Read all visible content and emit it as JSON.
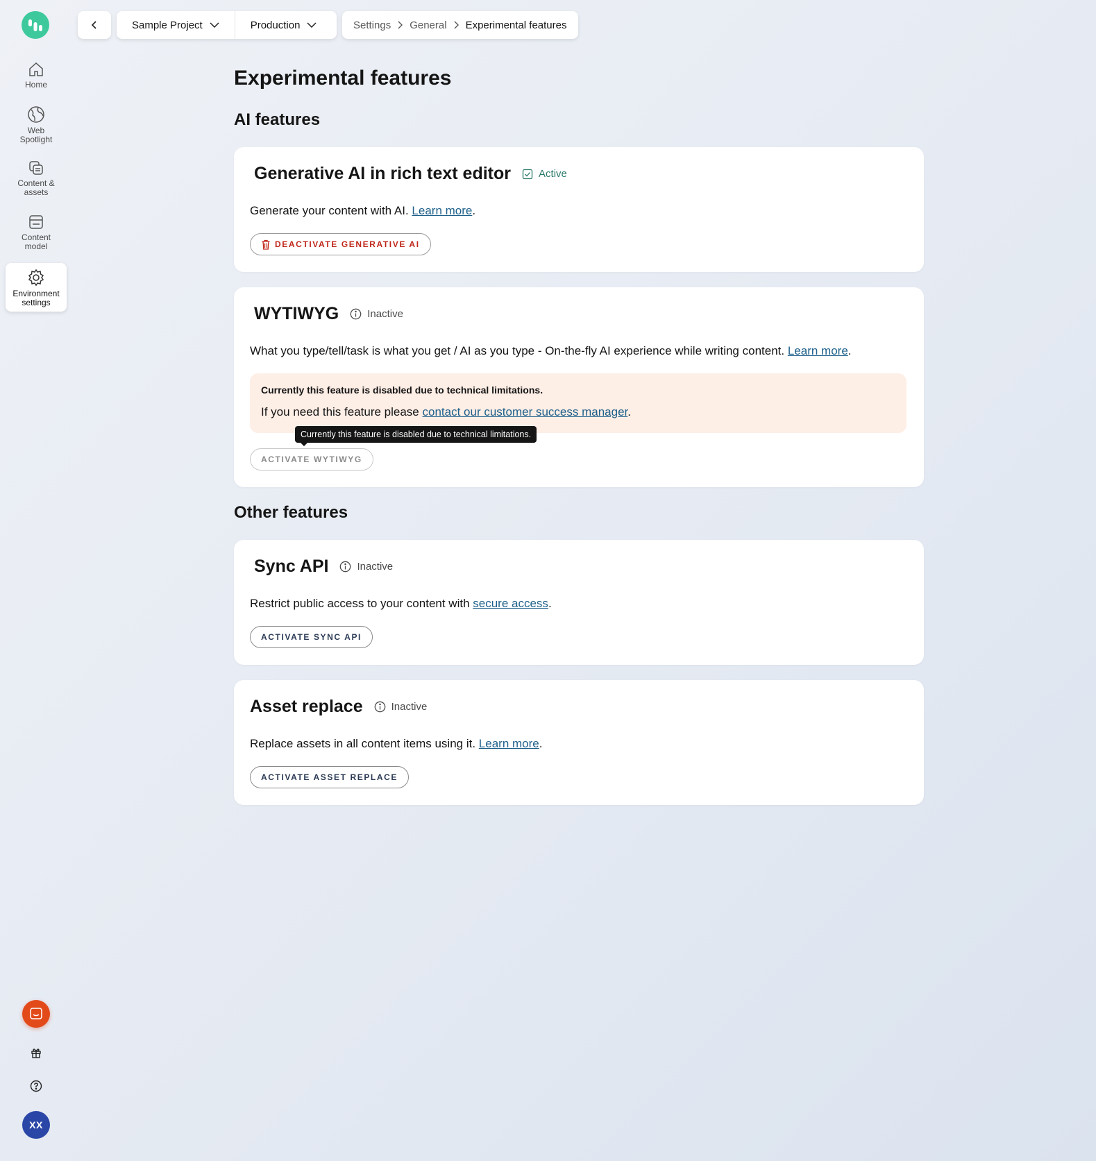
{
  "sidebar": {
    "items": [
      {
        "label_1": "Home",
        "label_2": ""
      },
      {
        "label_1": "Web",
        "label_2": "Spotlight"
      },
      {
        "label_1": "Content &",
        "label_2": "assets"
      },
      {
        "label_1": "Content",
        "label_2": "model"
      },
      {
        "label_1": "Environment",
        "label_2": "settings"
      }
    ],
    "avatar": "XX"
  },
  "topbar": {
    "project": "Sample Project",
    "environment": "Production",
    "breadcrumb": [
      "Settings",
      "General",
      "Experimental features"
    ]
  },
  "page": {
    "title": "Experimental features",
    "ai_section": "AI features",
    "other_section": "Other features"
  },
  "cards": {
    "genai": {
      "title": "Generative AI in rich text editor",
      "status": "Active",
      "desc": "Generate your content with AI.",
      "link": "Learn more",
      "button": "DEACTIVATE GENERATIVE AI"
    },
    "wytiwyg": {
      "title": "WYTIWYG",
      "status": "Inactive",
      "desc": "What you type/tell/task is what you get / AI as you type - On-the-fly AI experience while writing content.",
      "link": "Learn more",
      "warning_title": "Currently this feature is disabled due to technical limitations.",
      "warning_text": "If you need this feature please",
      "warning_link": "contact our customer success manager",
      "tooltip": "Currently this feature is disabled due to technical limitations.",
      "button": "ACTIVATE WYTIWYG"
    },
    "sync": {
      "title": "Sync API",
      "status": "Inactive",
      "desc": "Restrict public access to your content with",
      "link": "secure access",
      "button": "ACTIVATE SYNC API"
    },
    "asset": {
      "title": "Asset replace",
      "status": "Inactive",
      "desc": "Replace assets in all content items using it.",
      "link": "Learn more",
      "button": "ACTIVATE ASSET REPLACE"
    }
  },
  "colors": {
    "brand": "#3ec99d",
    "link": "#1d5f8a",
    "danger": "#c0271a",
    "active_status": "#2a7a6a",
    "warning_bg": "#fdeee6",
    "chat": "#e24a1a",
    "avatar": "#2a46a6"
  }
}
